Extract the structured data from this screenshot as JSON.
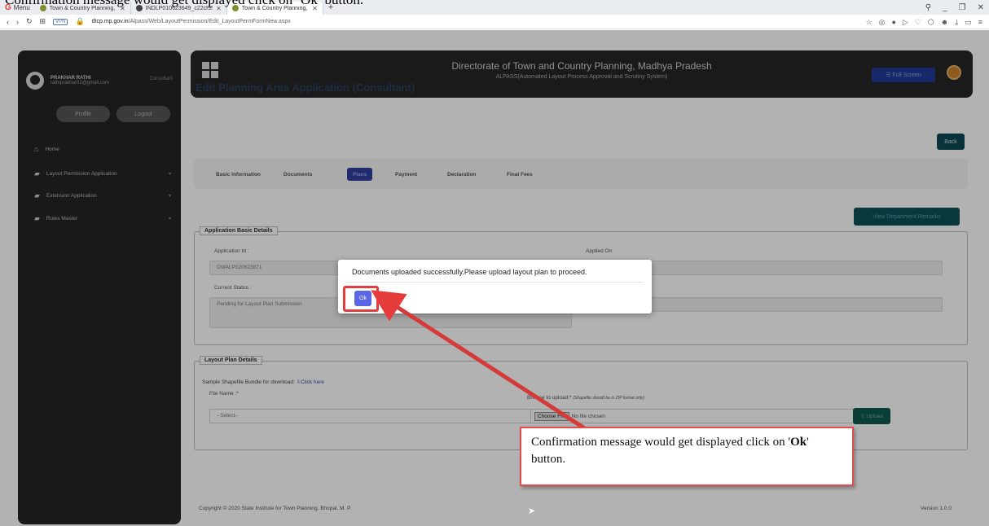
{
  "caption": "Confirmation message would get displayed click on ‘Ok’ button.",
  "browser": {
    "menu_label": "Menu",
    "tabs": [
      {
        "label": "Town & Country Planning,"
      },
      {
        "label": "INDLP010623649_c22cf95"
      },
      {
        "label": "Town & Country Planning,"
      }
    ],
    "new_tab": "+",
    "url_host": "dtcp.mp.gov.in",
    "url_path": "/Alpass/Web/LayoutPermission/Edit_LayoutPermFormNew.aspx",
    "vpn_badge": "VPN"
  },
  "sidebar": {
    "user_name": "PRAKHAR RATHI",
    "user_email": "rathiprakhar02@gmail.com",
    "user_role": "Consultant",
    "profile_label": "Profile",
    "logout_label": "Logout",
    "items": [
      {
        "label": "Home"
      },
      {
        "label": "Layout Permission Application"
      },
      {
        "label": "Extension Application"
      },
      {
        "label": "Rules Master"
      }
    ]
  },
  "header": {
    "title": "Directorate of Town and Country Planning, Madhya Pradesh",
    "subtitle": "ALPASS(Automated Layout Process Approval and Scrutiny System)"
  },
  "main": {
    "page_title": "Edit Planning Area Application (Consultant)",
    "fullscreen_label": "☰ Full Screen",
    "back_label": "Back",
    "tabs": [
      {
        "label": "Basic Information"
      },
      {
        "label": "Documents"
      },
      {
        "label": "Plans"
      },
      {
        "label": "Payment"
      },
      {
        "label": "Declaration"
      },
      {
        "label": "Final Fees"
      }
    ],
    "remarks_label": "View Department Remarks",
    "basic_details": {
      "legend": "Application Basic Details",
      "application_id_label": "Application Id :",
      "application_id": "DWALP020623871",
      "applied_on_label": "Applied On",
      "current_status_label": "Current Status :",
      "current_status": "Pending for Layout Plan Submission",
      "right_value": "41:54"
    },
    "plan_details": {
      "legend": "Layout Plan Details",
      "sample_text": "Sample Shapefile Bundle for download:",
      "sample_link": "⇩Click here",
      "file_name_label": "File Name :*",
      "select_placeholder": "--Select--",
      "browse_label": "Browse to upload:*",
      "browse_note": "(Shapefile should be in ZIP format only)",
      "choose_file": "Choose File",
      "no_file": "No file chosen",
      "upload_label": "⇧ Upload"
    },
    "footer_copyright": "Copyright © 2020 State Institute for Town Planning, Bhopal, M. P.",
    "footer_version": "Version 1.0.0"
  },
  "modal": {
    "message": "Documents uploaded successfully.Please upload layout plan to proceed.",
    "ok_label": "Ok"
  },
  "callout": {
    "text_before": "Confirmation message would get displayed click on '",
    "text_bold": "Ok",
    "text_after": "' button."
  },
  "colors": {
    "accent_blue": "#5966e8",
    "highlight_red": "#e53c3c",
    "sidebar_bg": "#242424"
  }
}
